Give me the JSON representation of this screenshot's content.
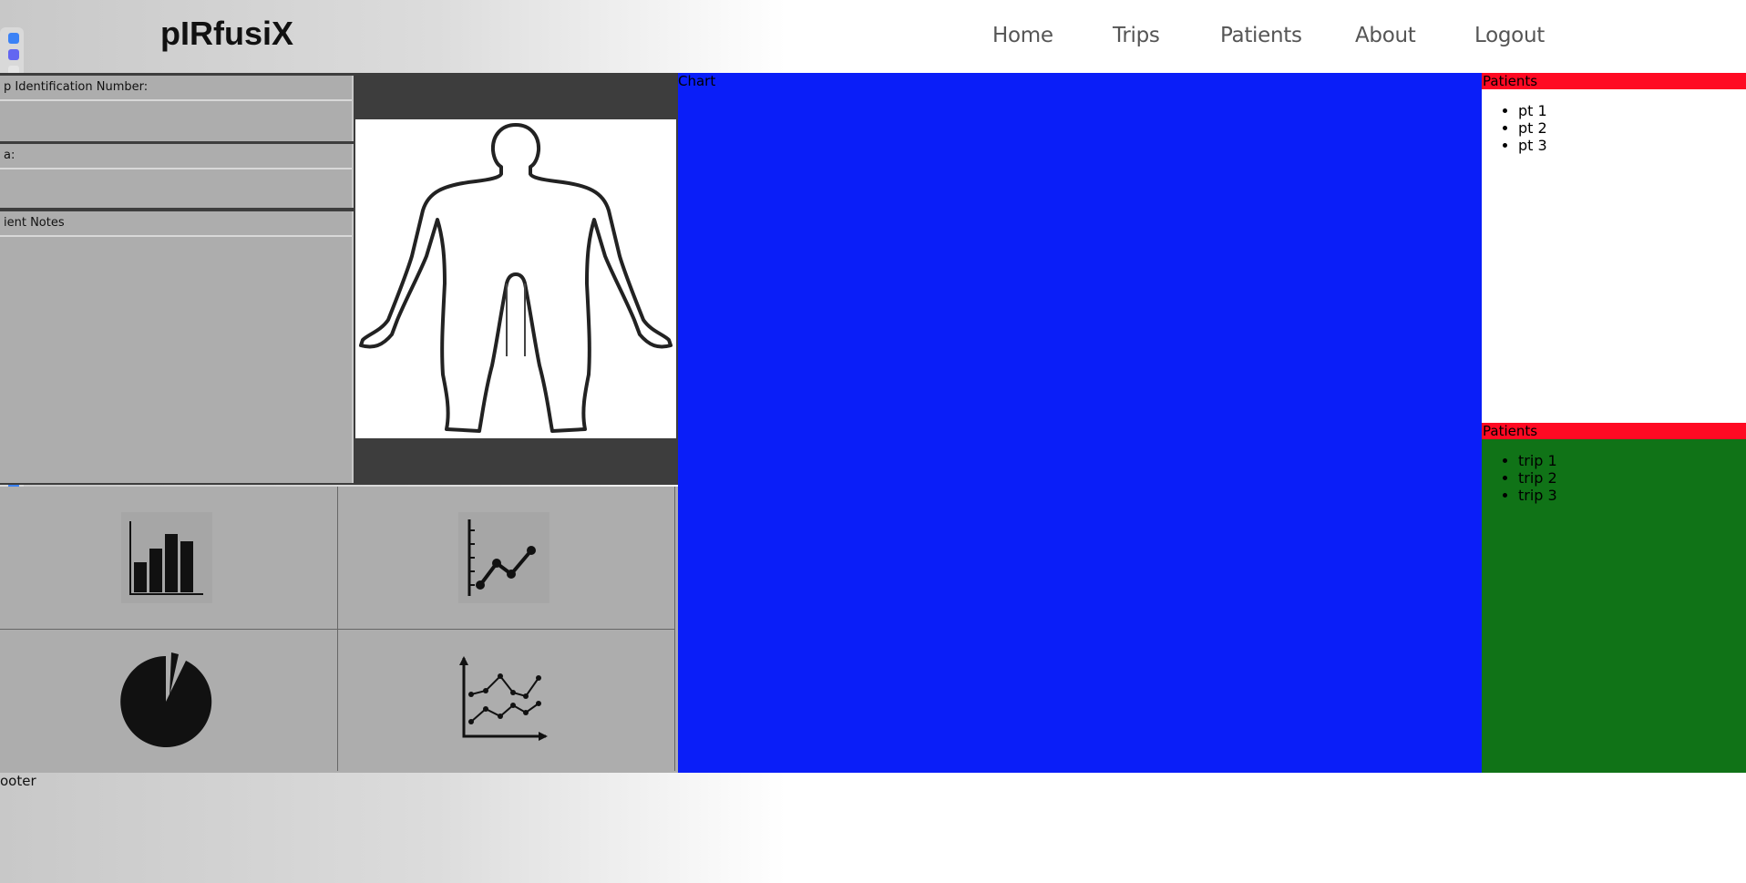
{
  "header": {
    "brand": "pIRfusiX",
    "nav": [
      "Home",
      "Trips",
      "Patients",
      "About",
      "Logout"
    ]
  },
  "form": {
    "id_label": "p Identification Number:",
    "second_label": "a:",
    "notes_label": "ient Notes"
  },
  "chart_panel": {
    "title": "Chart"
  },
  "patients_panel": {
    "title": "Patients",
    "items": [
      "pt 1",
      "pt 2",
      "pt 3"
    ]
  },
  "trips_panel": {
    "title": "Patients",
    "items": [
      "trip 1",
      "trip 2",
      "trip 3"
    ]
  },
  "footer": {
    "text": "ooter"
  },
  "colors": {
    "chart_bg": "#0a1ef8",
    "panel_head": "#ff0a23",
    "trips_bg": "#107317",
    "form_bg": "#adadad"
  },
  "icons": [
    "bar-chart-icon",
    "line-chart-icon",
    "pie-chart-icon",
    "multi-line-chart-icon"
  ]
}
